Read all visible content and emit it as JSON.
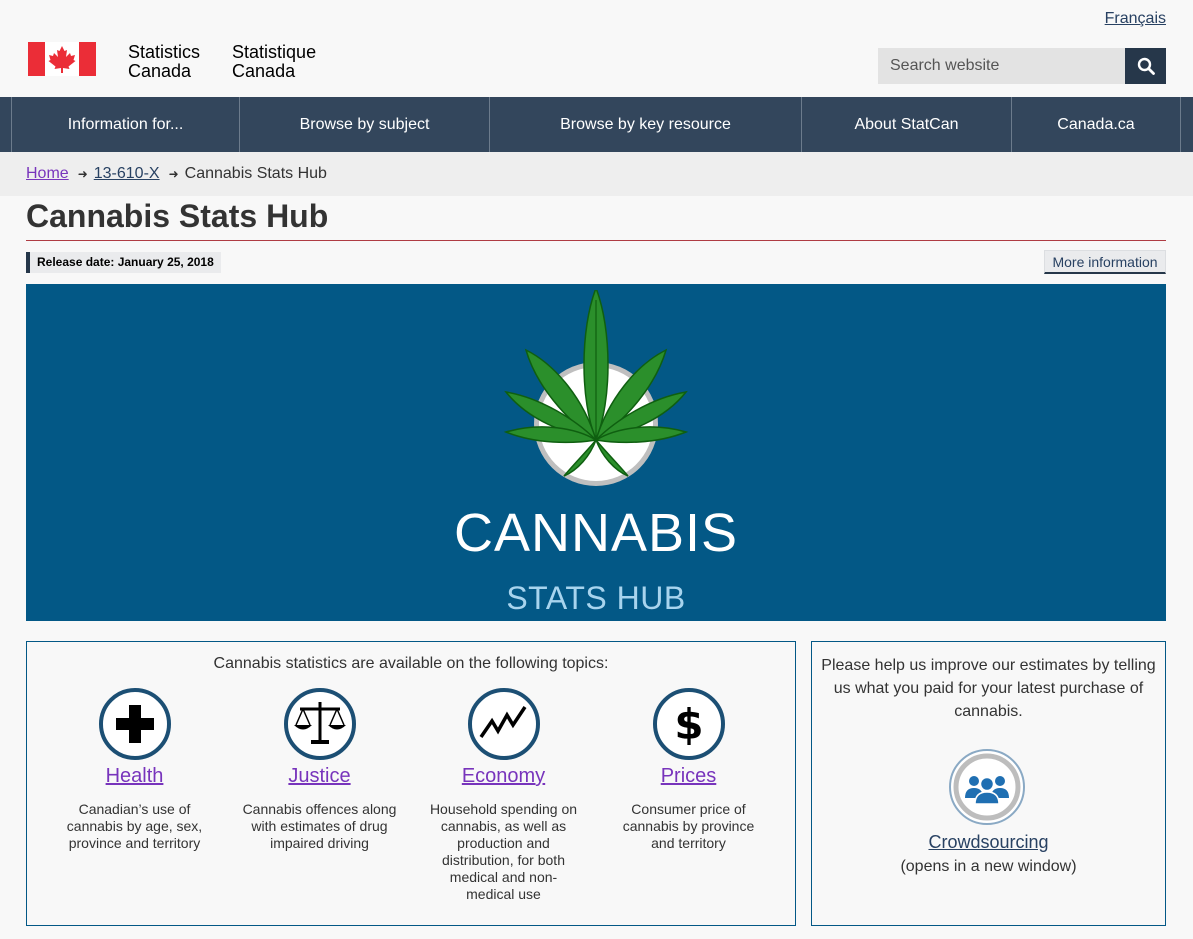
{
  "header": {
    "language_link": "Français",
    "brand_en_line1": "Statistics",
    "brand_en_line2": "Canada",
    "brand_fr_line1": "Statistique",
    "brand_fr_line2": "Canada",
    "search_placeholder": "Search website"
  },
  "menu": [
    {
      "label": "Information for..."
    },
    {
      "label": "Browse by subject"
    },
    {
      "label": "Browse by key resource"
    },
    {
      "label": "About StatCan"
    },
    {
      "label": "Canada.ca"
    }
  ],
  "breadcrumb": {
    "home": "Home",
    "catalogue": "13-610-X",
    "current": "Cannabis Stats Hub"
  },
  "page": {
    "title": "Cannabis Stats Hub",
    "release_date": "Release date: January 25, 2018",
    "more_info": "More information"
  },
  "banner": {
    "title": "CANNABIS",
    "subtitle": "STATS HUB"
  },
  "topics": {
    "intro": "Cannabis statistics are available on the following topics:",
    "items": [
      {
        "label": "Health",
        "desc": "Canadian’s use of cannabis by age, sex, province and territory",
        "icon": "plus-icon"
      },
      {
        "label": "Justice",
        "desc": "Cannabis offences along with estimates of drug impaired driving",
        "icon": "scales-icon"
      },
      {
        "label": "Economy",
        "desc": "Household spending on cannabis, as well as production and distribution, for both medical and non-medical use",
        "icon": "trend-line-icon"
      },
      {
        "label": "Prices",
        "desc": "Consumer price of cannabis by province and territory",
        "icon": "dollar-icon"
      }
    ]
  },
  "crowdsourcing": {
    "text": "Please help us improve our estimates by telling us what you paid for your latest purchase of cannabis.",
    "link": "Crowdsourcing",
    "note": "(opens in a new window)"
  },
  "colors": {
    "nav": "#33465c",
    "banner": "#035886",
    "link_visited": "#7834bc",
    "title_rule": "#af3c43"
  }
}
